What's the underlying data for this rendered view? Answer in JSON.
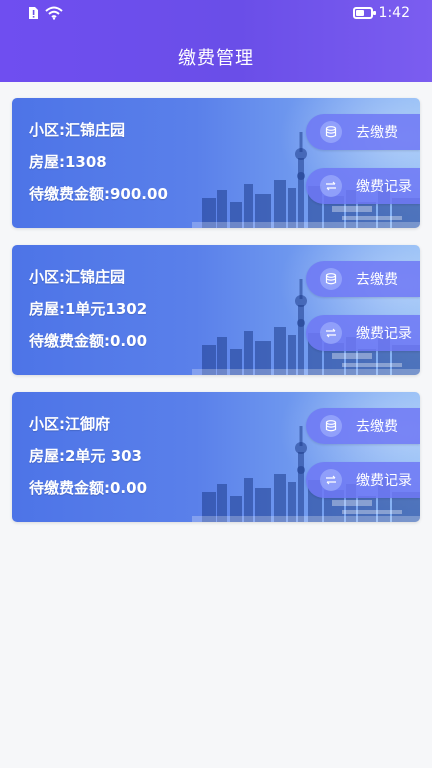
{
  "status_bar": {
    "time": "1:42",
    "icons": [
      "alert-sim-icon",
      "wifi-icon",
      "battery-icon"
    ]
  },
  "header": {
    "title": "缴费管理"
  },
  "colors": {
    "header": "#6a4ee8",
    "card": "#5a80ea",
    "button": "#6e78f5",
    "background": "#f6f7f9"
  },
  "cards": [
    {
      "community": "小区:汇锦庄园",
      "room": "房屋:1308",
      "amount": "待缴费金额:900.00",
      "pay_label": "去缴费",
      "record_label": "缴费记录"
    },
    {
      "community": "小区:汇锦庄园",
      "room": "房屋:1单元1302",
      "amount": "待缴费金额:0.00",
      "pay_label": "去缴费",
      "record_label": "缴费记录"
    },
    {
      "community": "小区:江御府",
      "room": "房屋:2单元 303",
      "amount": "待缴费金额:0.00",
      "pay_label": "去缴费",
      "record_label": "缴费记录"
    }
  ]
}
